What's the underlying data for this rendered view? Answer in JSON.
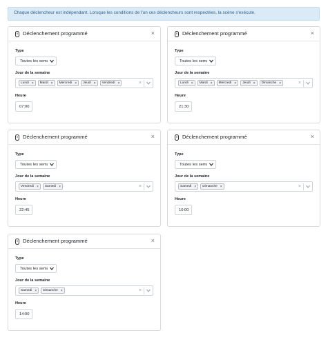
{
  "info": {
    "text": "Chaque déclencheur est indépendant. Lorsque les conditions de l'un ces déclencheurs sont respectées, la scène s'exécute."
  },
  "labels": {
    "type": "Type",
    "days": "Jour de la semaine",
    "hour": "Heure"
  },
  "triggers": [
    {
      "title": "Déclenchement programmé",
      "close": "×",
      "type_value": "Toutes les sema",
      "days": [
        "Lundi",
        "Mardi",
        "Mercredi",
        "Jeudi",
        "Vendredi"
      ],
      "hour": "07:00"
    },
    {
      "title": "Déclenchement programmé",
      "close": "×",
      "type_value": "Toutes les sema",
      "days": [
        "Lundi",
        "Mardi",
        "Mercredi",
        "Jeudi",
        "Dimanche"
      ],
      "hour": "21:30"
    },
    {
      "title": "Déclenchement programmé",
      "close": "×",
      "type_value": "Toutes les sema",
      "days": [
        "Vendredi",
        "Samedi"
      ],
      "hour": "22:45"
    },
    {
      "title": "Déclenchement programmé",
      "close": "×",
      "type_value": "Toutes les sema",
      "days": [
        "Samedi",
        "Dimanche"
      ],
      "hour": "10:00"
    },
    {
      "title": "Déclenchement programmé",
      "close": "×",
      "type_value": "Toutes les sema",
      "days": [
        "Samedi",
        "Dimanche"
      ],
      "hour": "14:00"
    }
  ],
  "icons": {
    "card": "clock-icon",
    "chip_remove": "×",
    "clear": "×",
    "dropdown": "chevron-down-icon"
  },
  "colors": {
    "info_bg": "#dbeaf7",
    "info_text": "#35638a",
    "border": "#d7dadd"
  }
}
